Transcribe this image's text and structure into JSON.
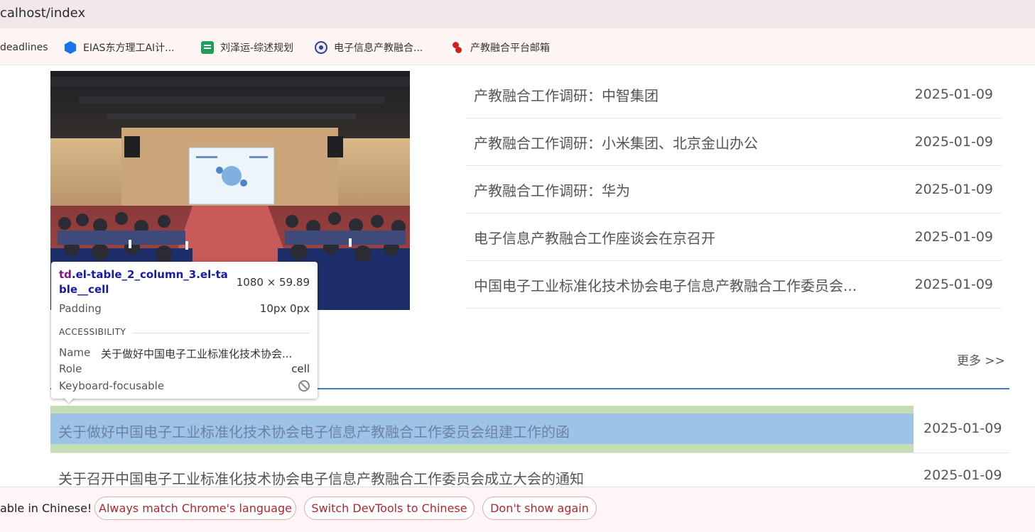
{
  "address_bar": {
    "url": "calhost/index"
  },
  "bookmarks": [
    {
      "label": "deadlines",
      "icon": ""
    },
    {
      "label": "EIAS东方理工AI计...",
      "icon": "hexagon-icon"
    },
    {
      "label": "刘泽运-综述规划",
      "icon": "sheets-icon"
    },
    {
      "label": "电子信息产教融合...",
      "icon": "seal-icon"
    },
    {
      "label": "产教融合平台邮箱",
      "icon": "mail-icon"
    }
  ],
  "news": [
    {
      "title": "产教融合工作调研：中智集团",
      "date": "2025-01-09"
    },
    {
      "title": "产教融合工作调研：小米集团、北京金山办公",
      "date": "2025-01-09"
    },
    {
      "title": "产教融合工作调研：华为",
      "date": "2025-01-09"
    },
    {
      "title": "电子信息产教融合工作座谈会在京召开",
      "date": "2025-01-09"
    },
    {
      "title": "中国电子工业标准化技术协会电子信息产教融合工作委员会...",
      "date": "2025-01-09"
    }
  ],
  "more_link": "更多 >>",
  "notices": [
    {
      "title": "关于做好中国电子工业标准化技术协会电子信息产教融合工作委员会组建工作的函",
      "date": "2025-01-09"
    },
    {
      "title": "关于召开中国电子工业标准化技术协会电子信息产教融合工作委员会成立大会的通知",
      "date": "2025-01-09"
    }
  ],
  "devtools_tooltip": {
    "selector_tag": "td",
    "selector_classes": ".el-table_2_column_3.el-table__cell",
    "size": "1080 × 59.89",
    "padding_label": "Padding",
    "padding_value": "10px 0px",
    "section": "ACCESSIBILITY",
    "name_label": "Name",
    "name_value": "关于做好中国电子工业标准化技术协会...",
    "role_label": "Role",
    "role_value": "cell",
    "focus_label": "Keyboard-focusable"
  },
  "translate_bar": {
    "text": "able in Chinese!",
    "buttons": [
      "Always match Chrome's language",
      "Switch DevTools to Chinese",
      "Don't show again"
    ],
    "accent": "#b0272f"
  }
}
